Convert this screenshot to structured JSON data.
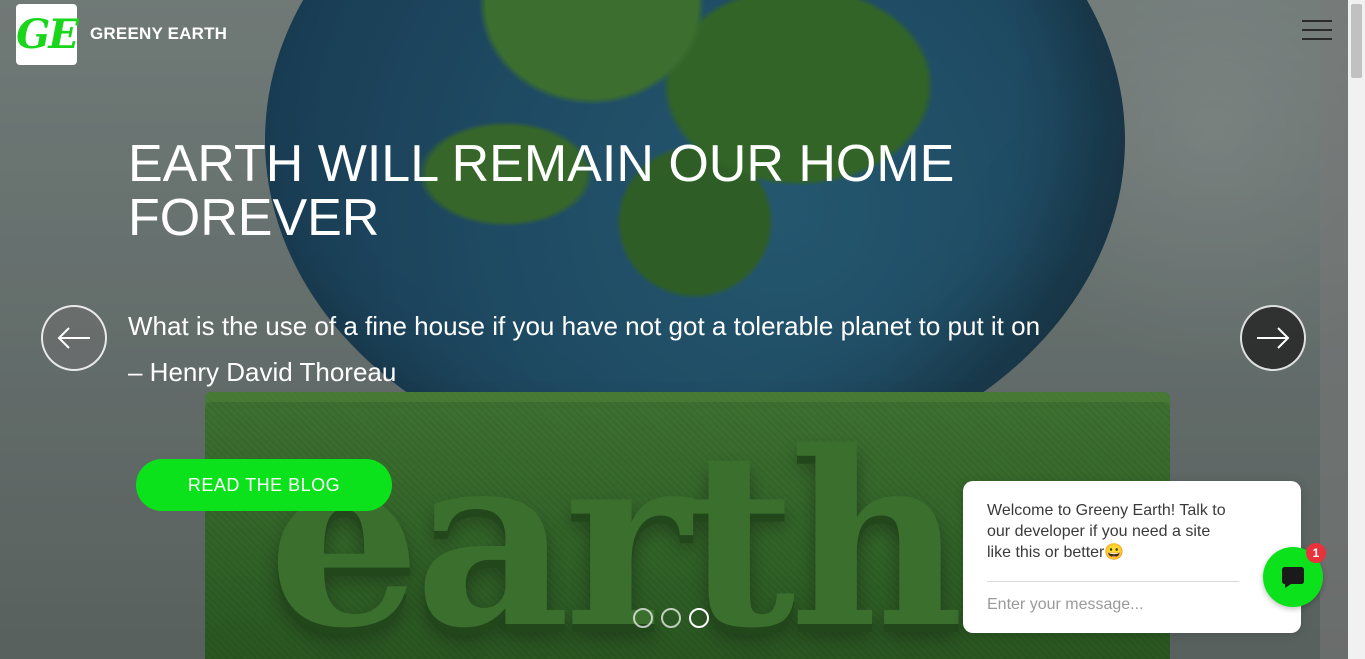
{
  "header": {
    "logo_text": "GE",
    "brand_name": "GREENY EARTH",
    "menu_icon": "hamburger-menu-icon"
  },
  "hero": {
    "headline": "EARTH WILL REMAIN OUR HOME FOREVER",
    "quote_line1": "What is the use of a fine house if you have not got a tolerable planet to put it on",
    "quote_line2": "– Henry David Thoreau",
    "cta_label": "READ THE BLOG",
    "background_lettering": "earth",
    "prev_icon": "arrow-left-icon",
    "next_icon": "arrow-right-icon",
    "slides_total": 3,
    "active_slide": 3
  },
  "chat": {
    "message": "Welcome to Greeny Earth! Talk to our developer if you need a site like this or better",
    "emoji": "😀",
    "input_placeholder": "Enter your message...",
    "badge_count": "1",
    "bubble_icon": "chat-bubble-icon"
  },
  "colors": {
    "accent_green": "#0ce21c",
    "logo_green": "#19d61a",
    "badge_red": "#e8323c"
  }
}
